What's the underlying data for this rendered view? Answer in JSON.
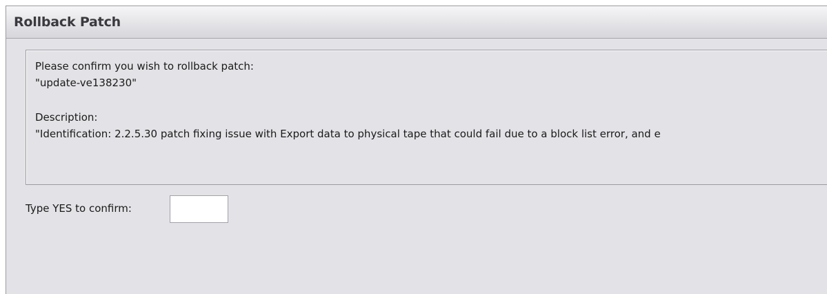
{
  "dialog": {
    "title": "Rollback Patch"
  },
  "message": {
    "prompt": "Please confirm you wish to rollback patch:",
    "patch_name": "\"update-ve138230\"",
    "description_label": "Description:",
    "description_text": "\"Identification: 2.2.5.30 patch fixing issue with Export data to physical tape that could fail due to a block list error, and e"
  },
  "confirm": {
    "label": "Type YES to confirm:",
    "value": ""
  }
}
